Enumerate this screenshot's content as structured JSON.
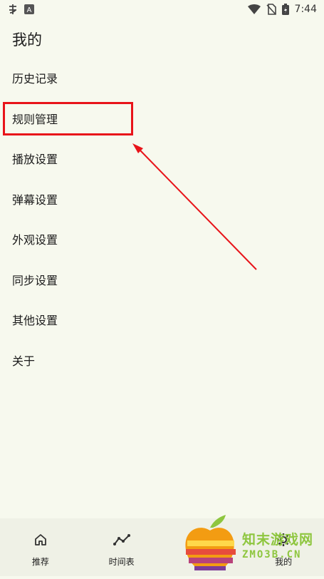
{
  "status_bar": {
    "time": "7:44",
    "icons": [
      "notification-app-icon",
      "a-badge-icon",
      "wifi-icon",
      "no-sim-icon",
      "battery-charging-icon"
    ]
  },
  "page": {
    "title": "我的"
  },
  "menu": {
    "items": [
      {
        "label": "历史记录"
      },
      {
        "label": "规则管理"
      },
      {
        "label": "播放设置"
      },
      {
        "label": "弹幕设置"
      },
      {
        "label": "外观设置"
      },
      {
        "label": "同步设置"
      },
      {
        "label": "其他设置"
      },
      {
        "label": "关于"
      }
    ]
  },
  "annotation": {
    "color": "#e8141a"
  },
  "bottom_nav": {
    "items": [
      {
        "label": "推荐",
        "icon": "home-icon"
      },
      {
        "label": "时间表",
        "icon": "timeline-icon"
      },
      {
        "label": "",
        "icon": "star-icon"
      },
      {
        "label": "我的",
        "icon": "gear-icon"
      }
    ]
  },
  "watermark": {
    "name_cn": "知末游戏网",
    "domain": "ZMO3B.CN"
  }
}
